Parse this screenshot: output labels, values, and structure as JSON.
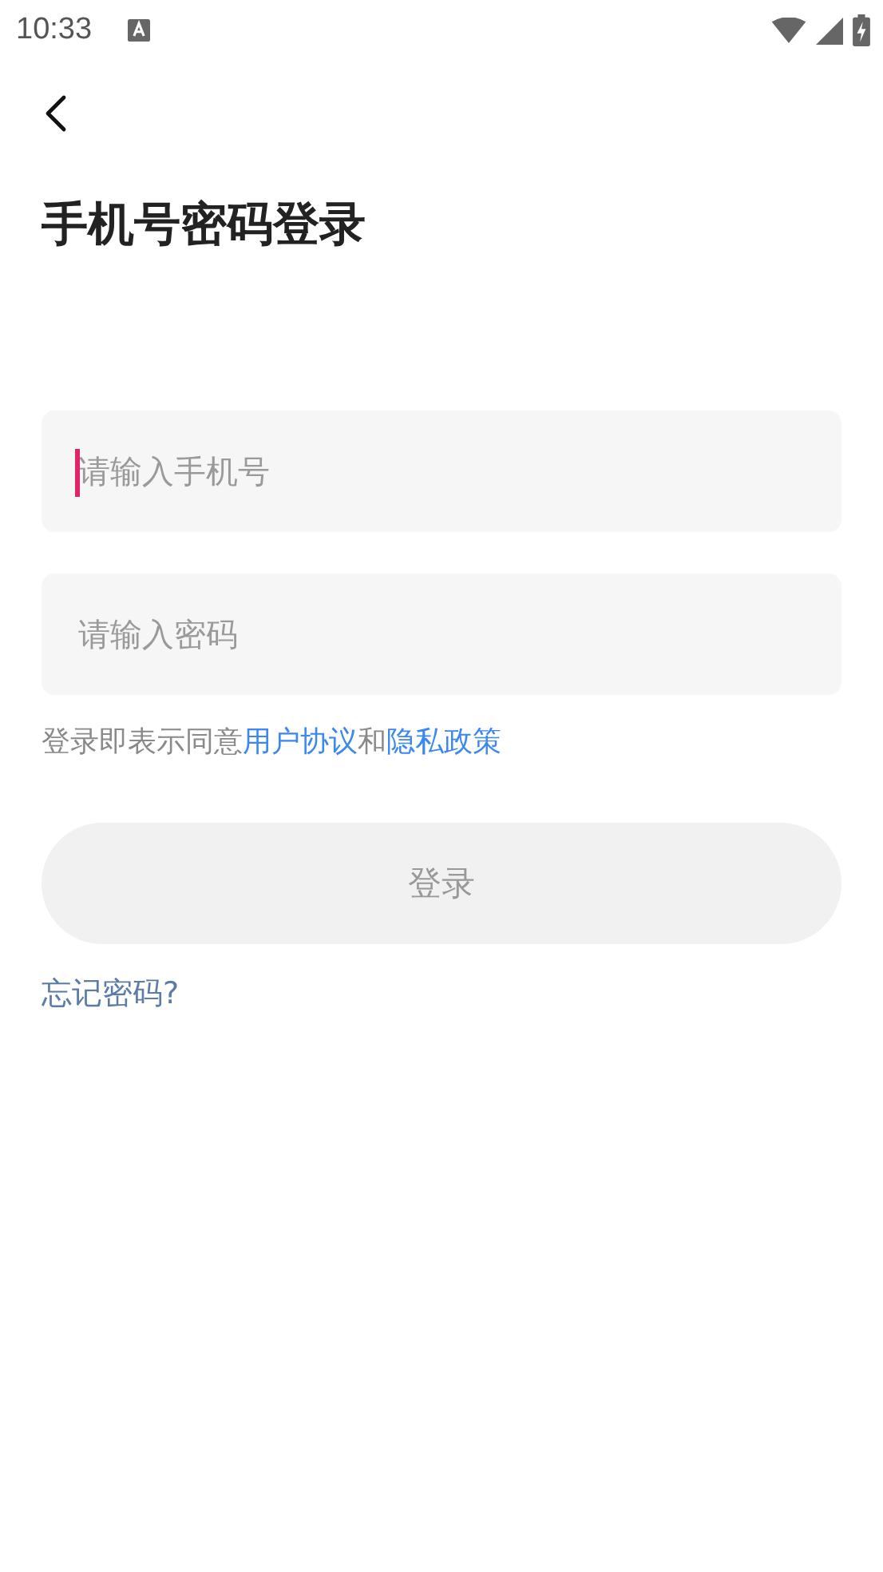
{
  "status_bar": {
    "time": "10:33"
  },
  "title": "手机号密码登录",
  "fields": [
    {
      "placeholder": "请输入手机号",
      "focused": true
    },
    {
      "placeholder": "请输入密码",
      "focused": false
    }
  ],
  "agreement": {
    "prefix": "登录即表示同意",
    "links": [
      {
        "text": "用户协议"
      },
      {
        "text": "隐私政策"
      }
    ],
    "joiner": "和"
  },
  "login_button": {
    "label": "登录",
    "disabled": true
  },
  "forgot_link": "忘记密码?"
}
